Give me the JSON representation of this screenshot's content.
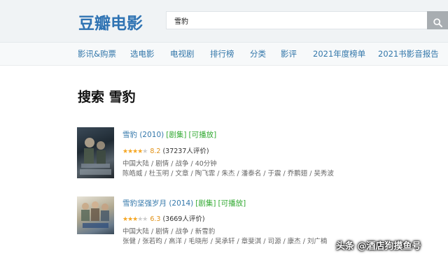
{
  "header": {
    "logo": "豆瓣电影",
    "search": {
      "value": "雪豹",
      "placeholder": ""
    },
    "search_button_icon": "search-icon"
  },
  "nav": [
    {
      "label": "影讯&购票"
    },
    {
      "label": "选电影"
    },
    {
      "label": "电视剧"
    },
    {
      "label": "排行榜"
    },
    {
      "label": "分类"
    },
    {
      "label": "影评"
    },
    {
      "label": "2021年度榜单"
    },
    {
      "label": "2021书影音报告"
    }
  ],
  "page": {
    "title": "搜索 雪豹"
  },
  "results": [
    {
      "title": "雪豹 (2010)",
      "tags": [
        "[剧集]",
        "[可播放]"
      ],
      "stars": 4,
      "score": "8.2",
      "votes": "(37237人评价)",
      "meta": "中国大陆 / 剧情 / 战争 / 40分钟",
      "cast": "陈皓威 / 杜玉明 / 文章 / 陶飞霏 / 朱杰 / 潘泰名 / 于震 / 乔鹏翅 / 吴秀波"
    },
    {
      "title": "雪豹坚强岁月 (2014)",
      "tags": [
        "[剧集]",
        "[可播放]"
      ],
      "stars": 3,
      "score": "6.3",
      "votes": "(3669人评价)",
      "meta": "中国大陆 / 剧情 / 战争 / 新雪豹",
      "cast": "张健 / 张若昀 / 高洋 / 毛晓彤 / 吴承轩 / 章斐淇 / 司源 / 康杰 / 刘广楠"
    }
  ],
  "watermark": "头条 @酒店狗摸鱼号",
  "colors": {
    "brand": "#2f73b3",
    "link": "#3377aa",
    "star": "#f5a623",
    "tag": "#33aa33"
  }
}
